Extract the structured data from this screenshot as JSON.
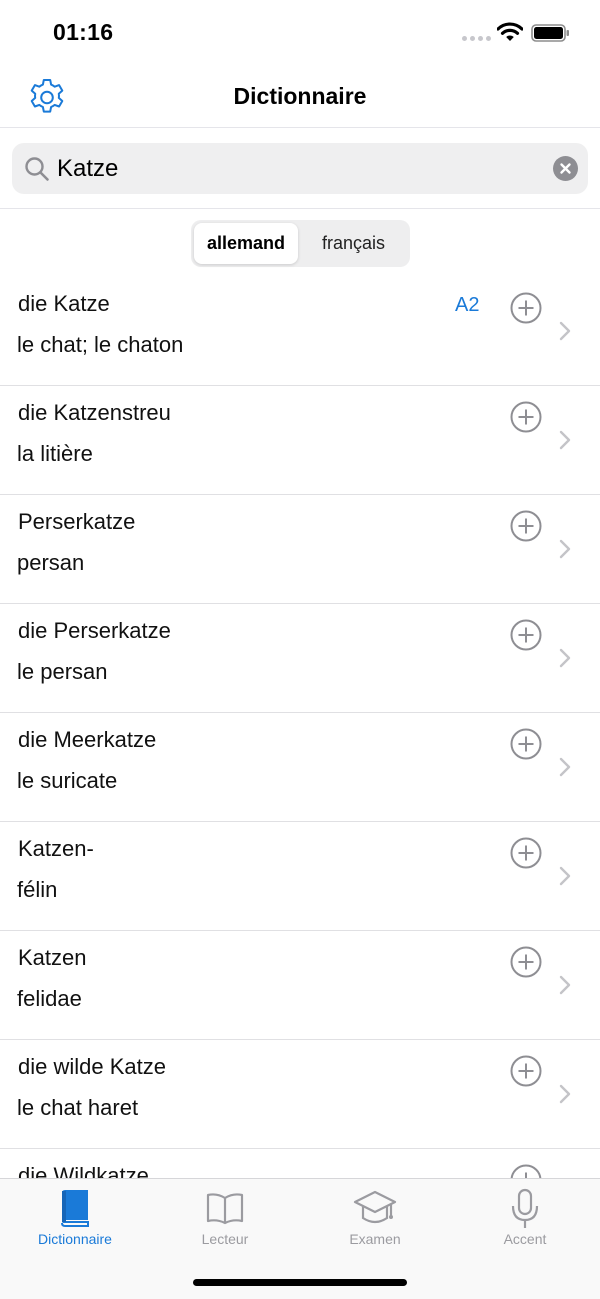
{
  "status": {
    "time": "01:16"
  },
  "nav": {
    "title": "Dictionnaire"
  },
  "search": {
    "value": "Katze"
  },
  "segments": [
    {
      "label": "allemand",
      "selected": true
    },
    {
      "label": "français",
      "selected": false
    }
  ],
  "entries": [
    {
      "word": "die Katze",
      "translation": "le chat; le chaton",
      "level": "A2"
    },
    {
      "word": "die Katzenstreu",
      "translation": "la litière",
      "level": ""
    },
    {
      "word": "Perserkatze",
      "translation": "persan",
      "level": ""
    },
    {
      "word": "die Perserkatze",
      "translation": "le persan",
      "level": ""
    },
    {
      "word": "die Meerkatze",
      "translation": "le suricate",
      "level": ""
    },
    {
      "word": "Katzen-",
      "translation": "félin",
      "level": ""
    },
    {
      "word": "Katzen",
      "translation": "felidae",
      "level": ""
    },
    {
      "word": "die wilde Katze",
      "translation": "le chat haret",
      "level": ""
    },
    {
      "word": "die Wildkatze",
      "translation": "",
      "level": ""
    }
  ],
  "tabs": [
    {
      "label": "Dictionnaire",
      "icon": "book-icon",
      "active": true
    },
    {
      "label": "Lecteur",
      "icon": "open-book-icon",
      "active": false
    },
    {
      "label": "Examen",
      "icon": "graduation-cap-icon",
      "active": false
    },
    {
      "label": "Accent",
      "icon": "microphone-icon",
      "active": false
    }
  ],
  "colors": {
    "accent": "#1a7ad8",
    "inactive": "#9b9ba0"
  }
}
